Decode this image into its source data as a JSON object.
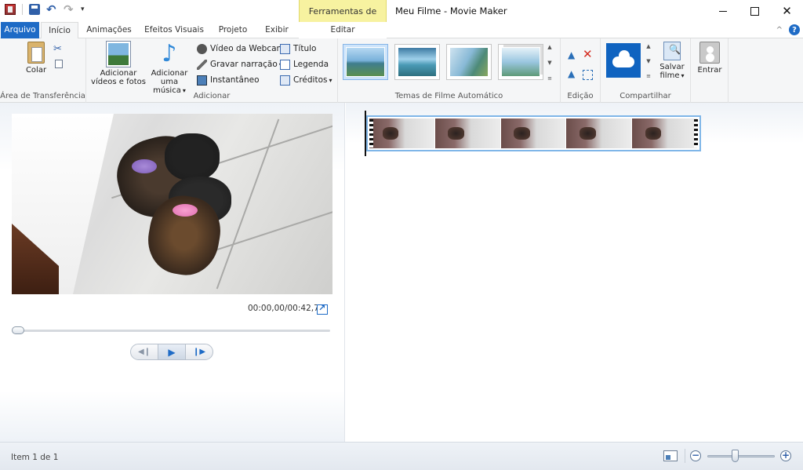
{
  "window": {
    "title": "Meu Filme - Movie Maker",
    "context_header": "Ferramentas de Vídeo",
    "controls": {
      "minimize": "—",
      "maximize": "□",
      "close": "✕"
    }
  },
  "qat": {
    "more": "▾"
  },
  "tabs": {
    "file": "Arquivo",
    "home": "Início",
    "animations": "Animações",
    "visual_effects": "Efeitos Visuais",
    "project": "Projeto",
    "view": "Exibir",
    "edit": "Editar"
  },
  "ribbon": {
    "collapse": "^",
    "help": "?",
    "clipboard": {
      "label": "Área de Transferência",
      "paste": "Colar"
    },
    "add": {
      "label": "Adicionar",
      "add_videos": "Adicionar vídeos e fotos",
      "add_videos_l1": "Adicionar",
      "add_videos_l2": "vídeos e fotos",
      "add_music_l1": "Adicionar",
      "add_music_l2": "uma música",
      "webcam": "Vídeo da Webcam",
      "narration": "Gravar narração",
      "snapshot": "Instantâneo",
      "title": "Título",
      "caption": "Legenda",
      "credits": "Créditos"
    },
    "themes": {
      "label": "Temas de Filme Automático"
    },
    "editing": {
      "label": "Edição"
    },
    "share": {
      "label": "Compartilhar",
      "save_l1": "Salvar",
      "save_l2": "filme",
      "signin": "Entrar"
    }
  },
  "preview": {
    "timecode": "00:00,00/00:42,73",
    "progress": 0
  },
  "status": {
    "item_count": "Item 1 de 1",
    "zoom_out": "−",
    "zoom_in": "+"
  }
}
